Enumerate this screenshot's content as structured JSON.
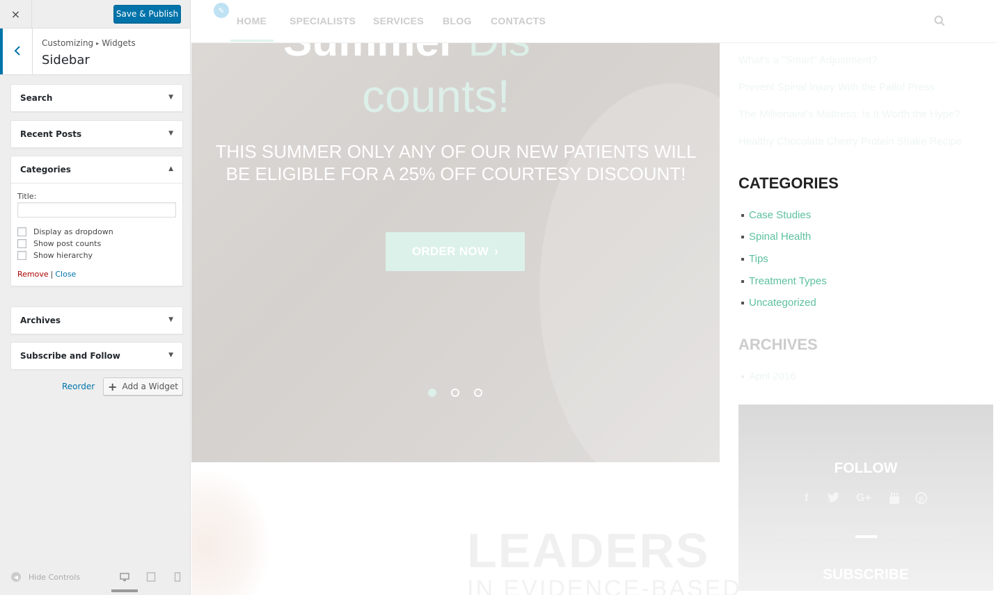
{
  "customizer": {
    "close_icon": "×",
    "publish_label": "Save & Publish",
    "breadcrumb": [
      "Customizing",
      "Widgets"
    ],
    "breadcrumb_separator": "▸",
    "section_title": "Sidebar",
    "widgets": [
      {
        "title": "Search",
        "expanded": false
      },
      {
        "title": "Recent Posts",
        "expanded": false
      },
      {
        "title": "Categories",
        "expanded": true
      },
      {
        "title": "Archives",
        "expanded": false
      },
      {
        "title": "Subscribe and Follow",
        "expanded": false
      }
    ],
    "categories_form": {
      "title_label": "Title:",
      "title_value": "",
      "options": [
        {
          "label": "Display as dropdown",
          "checked": false
        },
        {
          "label": "Show post counts",
          "checked": false
        },
        {
          "label": "Show hierarchy",
          "checked": false
        }
      ],
      "remove_label": "Remove",
      "separator": "|",
      "close_label": "Close"
    },
    "reorder_label": "Reorder",
    "add_widget_label": "Add a Widget",
    "hide_controls_label": "Hide Controls",
    "devices": [
      "desktop-icon",
      "tablet-icon",
      "mobile-icon"
    ]
  },
  "preview": {
    "nav": [
      "HOME",
      "SPECIALISTS",
      "SERVICES",
      "BLOG",
      "CONTACTS"
    ],
    "hero": {
      "title_line1_a": "Summer",
      "title_line1_b": " Dis",
      "title_line2": "counts!",
      "subtitle_line1": "THIS SUMMER ONLY ANY OF OUR NEW PATIENTS WILL",
      "subtitle_line2": "BE ELIGIBLE FOR A 25% OFF COURTESY DISCOUNT!",
      "button_label": "ORDER NOW",
      "button_arrow": "›",
      "slides": 3,
      "active_slide": 1
    },
    "recent_posts": [
      "What's a \"Smart\" Adjustment?",
      "Prevent Spinal Injury With the Pallof Press",
      "The Millionaire's Mattress: Is It Worth the Hype?",
      "Healthy Chocolate Cherry Protein Shake Recipe"
    ],
    "categories_heading": "CATEGORIES",
    "categories": [
      "Case Studies",
      "Spinal Health",
      "Tips",
      "Treatment Types",
      "Uncategorized"
    ],
    "archives_heading": "ARCHIVES",
    "archives": [
      "April 2016"
    ],
    "follow_heading": "FOLLOW",
    "social_icons": [
      "f",
      "🐦",
      "G+",
      "▶",
      "P"
    ],
    "subscribe_heading": "SUBSCRIBE",
    "leaders_heading": "LEADERS",
    "leaders_sub": "IN EVIDENCE-BASED"
  },
  "colors": {
    "accent": "#0073aa",
    "mint": "#5cc0a0",
    "remove": "#aa0000"
  }
}
